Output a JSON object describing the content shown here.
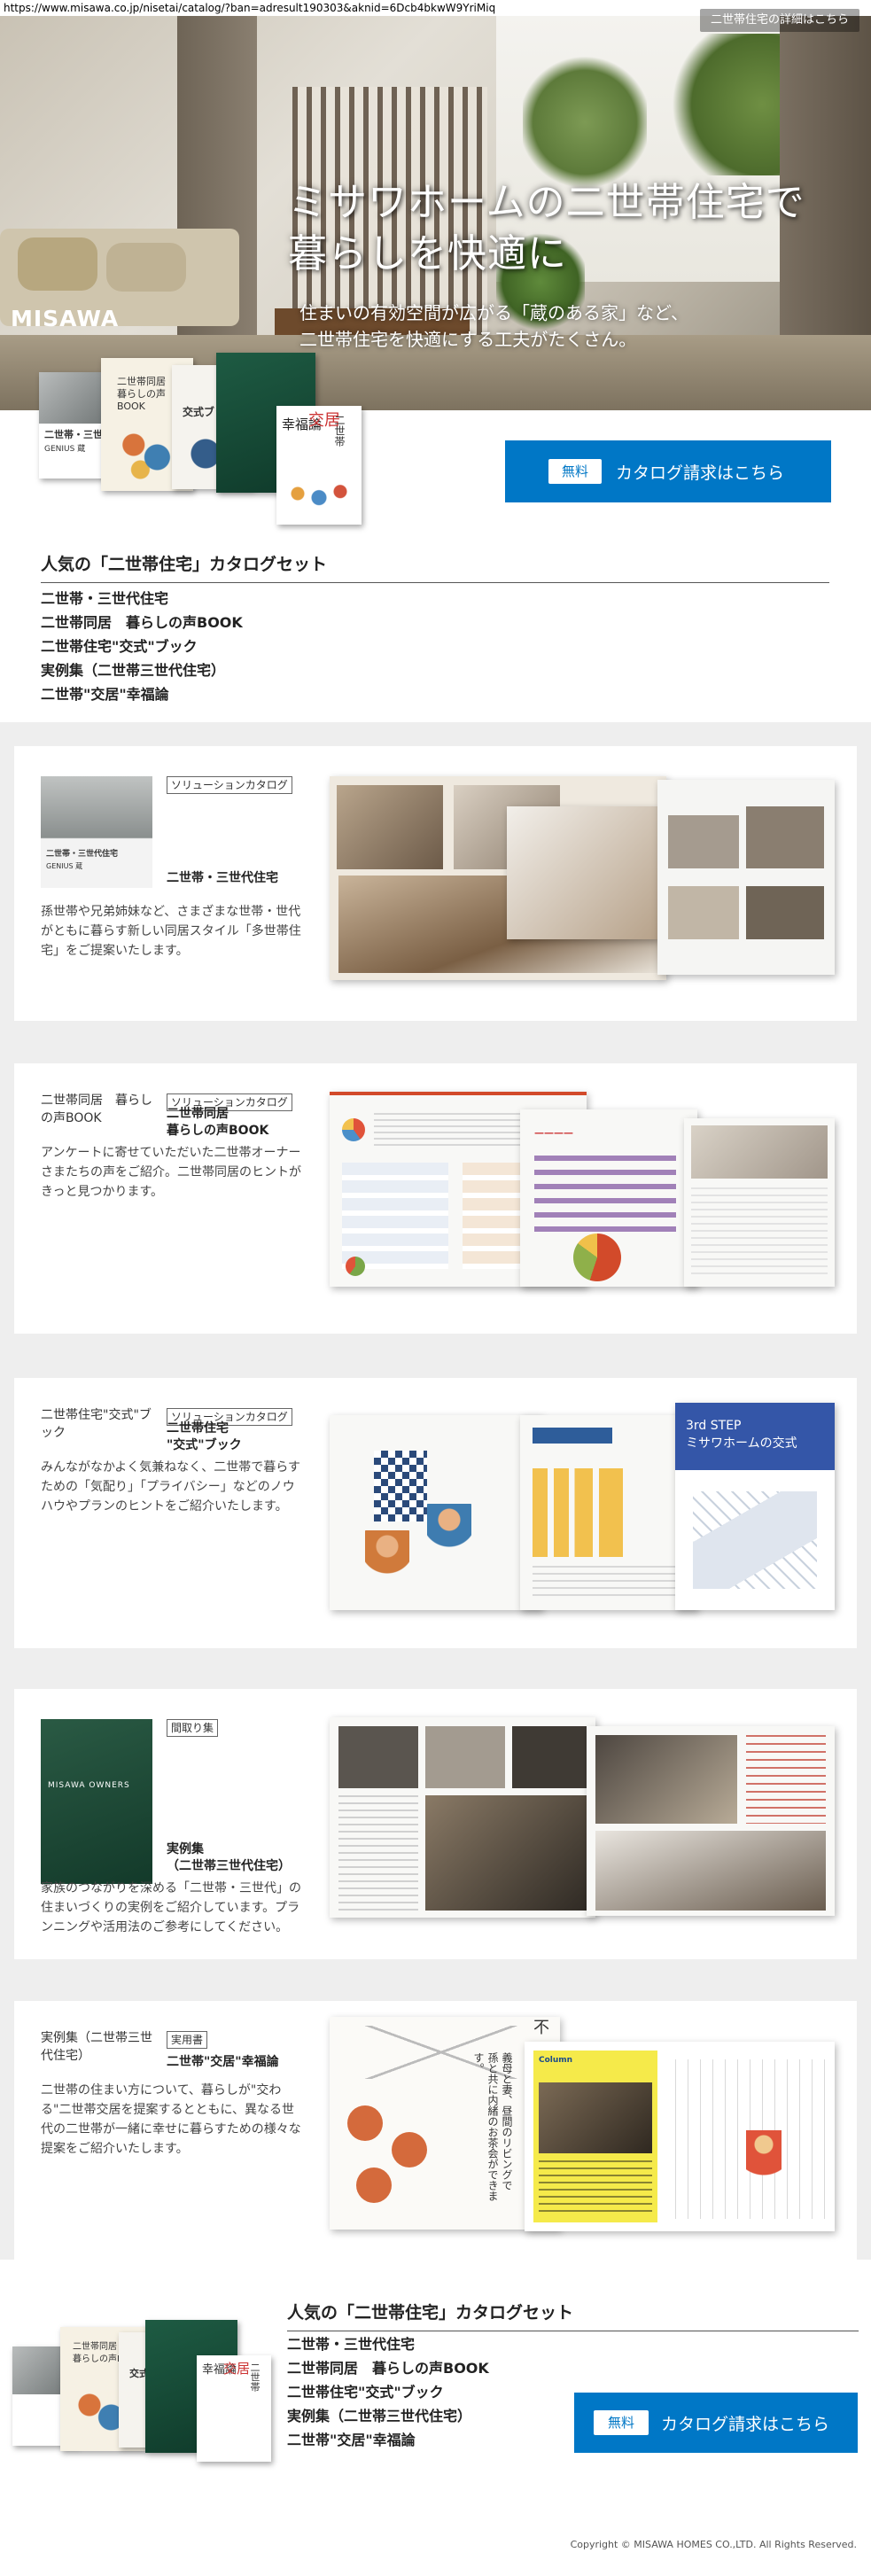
{
  "browser": {
    "url": "https://www.misawa.co.jp/nisetai/catalog/?ban=adresult190303&aknid=6Dcb4bkwW9YriMiq"
  },
  "hero": {
    "logo": "MISAWA",
    "detail_link": "二世帯住宅の詳細はこちら",
    "title": "ミサワホームの二世帯住宅で\n暮らしを快適に",
    "subtitle": "住まいの有効空間が広がる「蔵のある家」など、\n二世帯住宅を快適にする工夫がたくさん。"
  },
  "cover_books": {
    "book1_title": "二世帯・三世代",
    "book1_brand": "GENIUS 蔵",
    "book2_title": "二世帯同居\n暮らしの声BOOK",
    "book3_title": "交式ブック",
    "book4_title": "幸福論",
    "book4_sub": "二世帯",
    "book4_kanji": "交居"
  },
  "cta": {
    "free_label": "無料",
    "button_label": "カタログ請求はこちら"
  },
  "catalog_set": {
    "heading": "人気の「二世帯住宅」カタログセット",
    "items": [
      "二世帯・三世代住宅",
      "二世帯同居　暮らしの声BOOK",
      "二世帯住宅\"交式\"ブック",
      "実例集（二世帯三世代住宅）",
      "二世帯\"交居\"幸福論"
    ]
  },
  "catalogs": [
    {
      "tag": "ソリューションカタログ",
      "title": "二世帯・三世代住宅",
      "thumb_title": "二世帯・三世代住宅",
      "thumb_brand": "GENIUS 蔵",
      "description": "孫世帯や兄弟姉妹など、さまざまな世帯・世代がともに暮らす新しい同居スタイル「多世帯住宅」をご提案いたします。"
    },
    {
      "tag": "ソリューションカタログ",
      "title": "二世帯同居\n暮らしの声BOOK",
      "image_alt": "二世帯同居　暮らしの声BOOK",
      "description": "アンケートに寄せていただいた二世帯オーナーさまたちの声をご紹介。二世帯同居のヒントがきっと見つかります。"
    },
    {
      "tag": "ソリューションカタログ",
      "title": "二世帯住宅\n\"交式\"ブック",
      "image_alt": "二世帯住宅\"交式\"ブック",
      "description": "みんながなかよく気兼ねなく、二世帯で暮らすための「気配り」「プライバシー」などのノウハウやプランのヒントをご紹介いたします。",
      "spread_heading": "3rd STEP\nミサワホームの交式"
    },
    {
      "tag": "間取り集",
      "title": "実例集\n（二世帯三世代住宅）",
      "thumb_title": "MISAWA OWNERS",
      "description": "家族のつながりを深める「二世帯・三世代」の住まいづくりの実例をご紹介しています。プランニングや活用法のご参考にしてください。"
    },
    {
      "tag": "実用書",
      "title": "二世帯\"交居\"幸福論",
      "image_alt": "実例集（二世帯三世代住宅）",
      "description": "二世帯の住まい方について、暮らしが\"交わる\"二世帯交居を提案するとともに、異なる世代の二世帯が一緒に幸せに暮らすための様々な提案をご紹介いたします。",
      "spread_mark": "不",
      "spread_quote": "義母と妻、昼間のリビングで\n孫と共に内緒のお茶会ができます。",
      "column_label": "Column"
    }
  ],
  "bottom_set": {
    "heading": "人気の「二世帯住宅」カタログセット",
    "items": [
      "二世帯・三世代住宅",
      "二世帯同居　暮らしの声BOOK",
      "二世帯住宅\"交式\"ブック",
      "実例集（二世帯三世代住宅）",
      "二世帯\"交居\"幸福論"
    ]
  },
  "footer": {
    "copyright": "Copyright © MISAWA HOMES CO.,LTD. All Rights Reserved."
  },
  "colors": {
    "brand_blue": "#0077c6",
    "grey_bg": "#eeeeee",
    "accent_red": "#d24a2a",
    "spread_blue": "#3456a8"
  }
}
